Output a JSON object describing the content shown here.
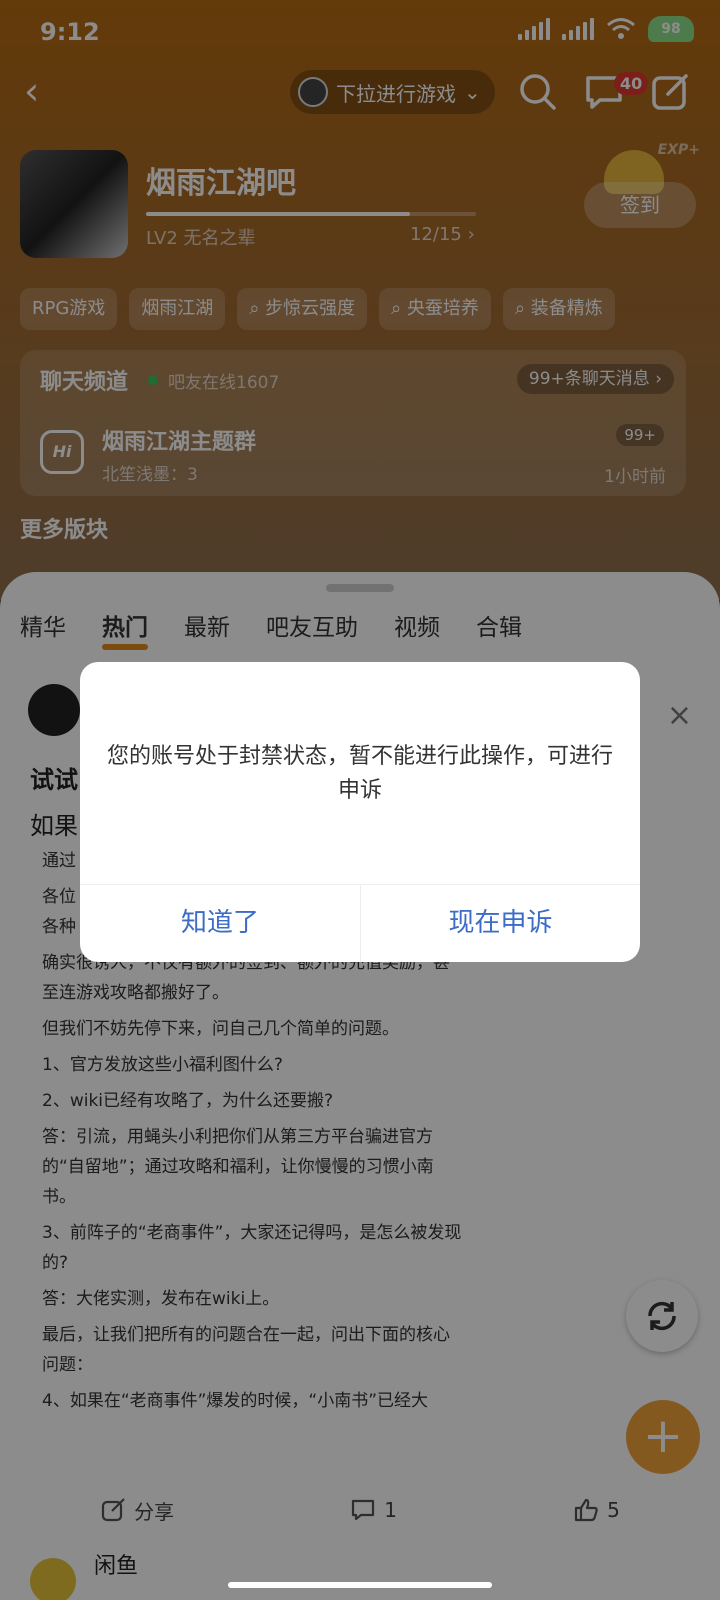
{
  "status_bar": {
    "time": "9:12",
    "battery": "98"
  },
  "nav": {
    "pill_text": "下拉进行游戏",
    "message_badge": "40"
  },
  "forum": {
    "name": "烟雨江湖吧",
    "level_text": "LV2 无名之辈",
    "level_count": "12/15",
    "level_progress": 0.8,
    "sign_label": "签到",
    "exp_label": "EXP+"
  },
  "tags": [
    "RPG游戏",
    "烟雨江湖",
    "步惊云强度",
    "央蚕培养",
    "装备精炼"
  ],
  "chat": {
    "title": "聊天频道",
    "online": "吧友在线1607",
    "messages": "99+条聊天消息",
    "group_name": "烟雨江湖主题群",
    "group_last": "北笙浅墨：3",
    "group_badge": "99+",
    "group_time": "1小时前",
    "group_icon": "Hi"
  },
  "more_title": "更多版块",
  "sheet": {
    "tabs": [
      "精华",
      "热门",
      "最新",
      "吧友互助",
      "视频",
      "合辑"
    ],
    "active_tab": "热门"
  },
  "post": {
    "title": "试试",
    "subtitle": "如果",
    "paragraphs": [
      "通过",
      "各位",
      "各种",
      "确实很诱人，不仅有额外的签到、额外的充值奖励，甚至连游戏攻略都搬好了。",
      "但我们不妨先停下来，问自己几个简单的问题。",
      "1、官方发放这些小福利图什么?",
      "2、wiki已经有攻略了，为什么还要搬?",
      "答：引流，用蝇头小利把你们从第三方平台骗进官方的“自留地”；通过攻略和福利，让你慢慢的习惯小南书。",
      "3、前阵子的“老商事件”，大家还记得吗，是怎么被发现的?",
      "答：大佬实测，发布在wiki上。",
      "最后，让我们把所有的问题合在一起，问出下面的核心问题：",
      "4、如果在“老商事件”爆发的时候，“小南书”已经大"
    ],
    "actions": {
      "share": "分享",
      "comments": "1",
      "likes": "5"
    }
  },
  "next_post": {
    "name": "闲鱼"
  },
  "dialog": {
    "message": "您的账号处于封禁状态，暂不能进行此操作，可进行申诉",
    "btn_ok": "知道了",
    "btn_appeal": "现在申诉"
  },
  "colors": {
    "accent": "#e08a1a",
    "dialog_button": "#3c6cc8",
    "fab": "#f0a23a"
  }
}
